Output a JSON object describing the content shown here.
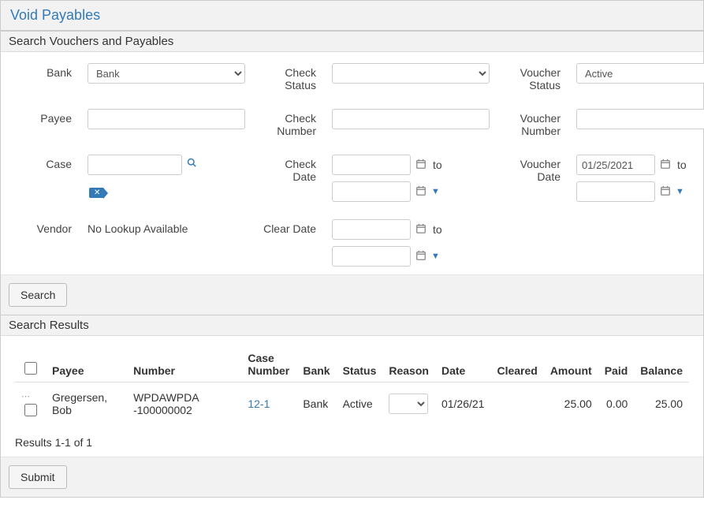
{
  "page_title": "Void Payables",
  "search_section_title": "Search Vouchers and Payables",
  "labels": {
    "bank": "Bank",
    "payee": "Payee",
    "case": "Case",
    "vendor": "Vendor",
    "check_status": "Check Status",
    "check_number": "Check Number",
    "check_date": "Check Date",
    "clear_date": "Clear Date",
    "voucher_status": "Voucher Status",
    "voucher_number": "Voucher Number",
    "voucher_date": "Voucher Date",
    "to": "to"
  },
  "fields": {
    "bank_selected": "Bank",
    "payee": "",
    "case": "",
    "vendor_text": "No Lookup Available",
    "check_status_selected": "",
    "check_number": "",
    "check_date_from": "",
    "check_date_to": "",
    "clear_date_from": "",
    "clear_date_to": "",
    "voucher_status_selected": "Active",
    "voucher_number": "",
    "voucher_date_from": "01/25/2021",
    "voucher_date_to": ""
  },
  "buttons": {
    "search": "Search",
    "submit": "Submit"
  },
  "results_section_title": "Search Results",
  "results": {
    "columns": {
      "payee": "Payee",
      "number": "Number",
      "case_number": "Case Number",
      "bank": "Bank",
      "status": "Status",
      "reason": "Reason",
      "date": "Date",
      "cleared": "Cleared",
      "amount": "Amount",
      "paid": "Paid",
      "balance": "Balance"
    },
    "rows": [
      {
        "payee": "Gregersen, Bob",
        "number": "WPDAWPDA -100000002",
        "case_number": "12-1",
        "bank": "Bank",
        "status": "Active",
        "reason": "",
        "date": "01/26/21",
        "cleared": "",
        "amount": "25.00",
        "paid": "0.00",
        "balance": "25.00"
      }
    ],
    "count_text": "Results 1-1 of 1"
  }
}
